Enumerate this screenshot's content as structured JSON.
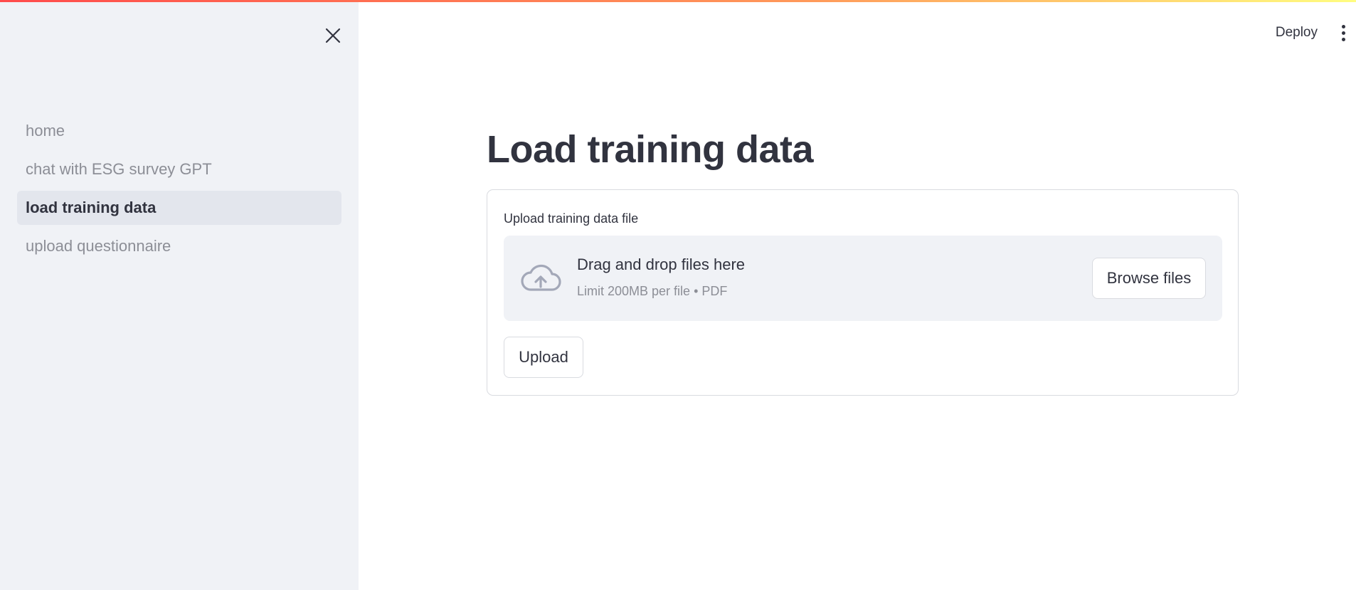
{
  "colors": {
    "sidebar_bg": "#f0f2f6",
    "text_primary": "#31333f",
    "text_muted": "#8c8e96",
    "active_nav_bg": "#e3e6ed",
    "accent_gradient_start": "#ff4b4b",
    "accent_gradient_end": "#fffd80"
  },
  "sidebar": {
    "close_icon": "close-icon",
    "items": [
      {
        "label": "home",
        "active": false
      },
      {
        "label": "chat with ESG survey GPT",
        "active": false
      },
      {
        "label": "load training data",
        "active": true
      },
      {
        "label": "upload questionnaire",
        "active": false
      }
    ]
  },
  "header": {
    "deploy_label": "Deploy",
    "menu_icon": "more-vertical-icon"
  },
  "main": {
    "title": "Load training data",
    "uploader": {
      "label": "Upload training data file",
      "drop_text": "Drag and drop files here",
      "limit_text": "Limit 200MB per file • PDF",
      "browse_label": "Browse files",
      "icon": "cloud-upload-icon"
    },
    "upload_button_label": "Upload"
  }
}
